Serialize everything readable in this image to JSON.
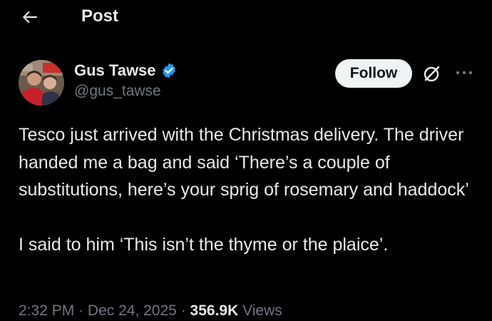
{
  "header": {
    "title": "Post"
  },
  "author": {
    "display_name": "Gus Tawse",
    "handle": "@gus_tawse",
    "verified": true
  },
  "actions": {
    "follow_label": "Follow"
  },
  "post": {
    "paragraph_1": "Tesco just arrived with the Christmas delivery. The driver handed me a bag and said ‘There’s a couple of substitutions, here’s your sprig of rosemary and haddock’",
    "paragraph_2": "I said to him ‘This isn’t the thyme or the plaice’."
  },
  "meta": {
    "time": "2:32 PM",
    "separator": "·",
    "date": "Dec 24, 2025",
    "views_count": "356.9K",
    "views_label": "Views"
  },
  "colors": {
    "background": "#000000",
    "primary_text": "#e7e9ea",
    "secondary_text": "#71767b",
    "verified_badge": "#1d9bf0",
    "follow_button_bg": "#eff3f4"
  },
  "icons": {
    "back": "arrow-left-icon",
    "verified": "verified-badge-icon",
    "grok": "grok-icon",
    "more": "more-horizontal-icon"
  }
}
